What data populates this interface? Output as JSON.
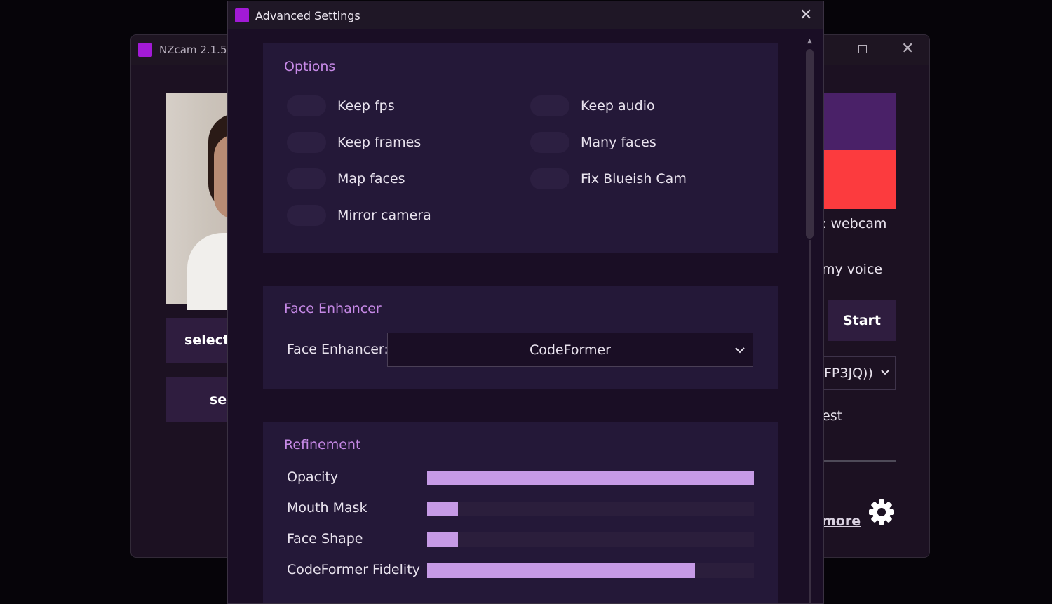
{
  "background_window": {
    "title": "NZcam 2.1.5",
    "buttons": [
      "select",
      "sel"
    ],
    "right_texts": {
      "webcam": "webcam",
      "voice": "my voice",
      "start": "Start",
      "camera_select": "FP3JQ))",
      "est": "est",
      "more": "more"
    }
  },
  "dialog": {
    "title": "Advanced Settings",
    "options": {
      "title": "Options",
      "left": [
        "Keep fps",
        "Keep frames",
        "Map faces",
        "Mirror camera"
      ],
      "right": [
        "Keep audio",
        "Many faces",
        "Fix Blueish Cam"
      ]
    },
    "enhancer": {
      "title": "Face Enhancer",
      "label": "Face Enhancer:",
      "selected": "CodeFormer"
    },
    "refinement": {
      "title": "Refinement",
      "sliders": [
        {
          "label": "Opacity",
          "value": 1.0
        },
        {
          "label": "Mouth Mask",
          "value": 0.095
        },
        {
          "label": "Face Shape",
          "value": 0.095
        },
        {
          "label": "CodeFormer Fidelity",
          "value": 0.82
        }
      ]
    }
  },
  "colors": {
    "accent": "#c689e6",
    "slider_fill": "#c69ae6",
    "logo": "#a21ad6",
    "preview_top": "#4a2168",
    "preview_bottom": "#fc3b3e"
  },
  "icons": {
    "logo": "app-logo-icon",
    "close": "close-icon",
    "maximize": "maximize-icon",
    "chevron": "chevron-down-icon",
    "gear": "gear-icon"
  }
}
